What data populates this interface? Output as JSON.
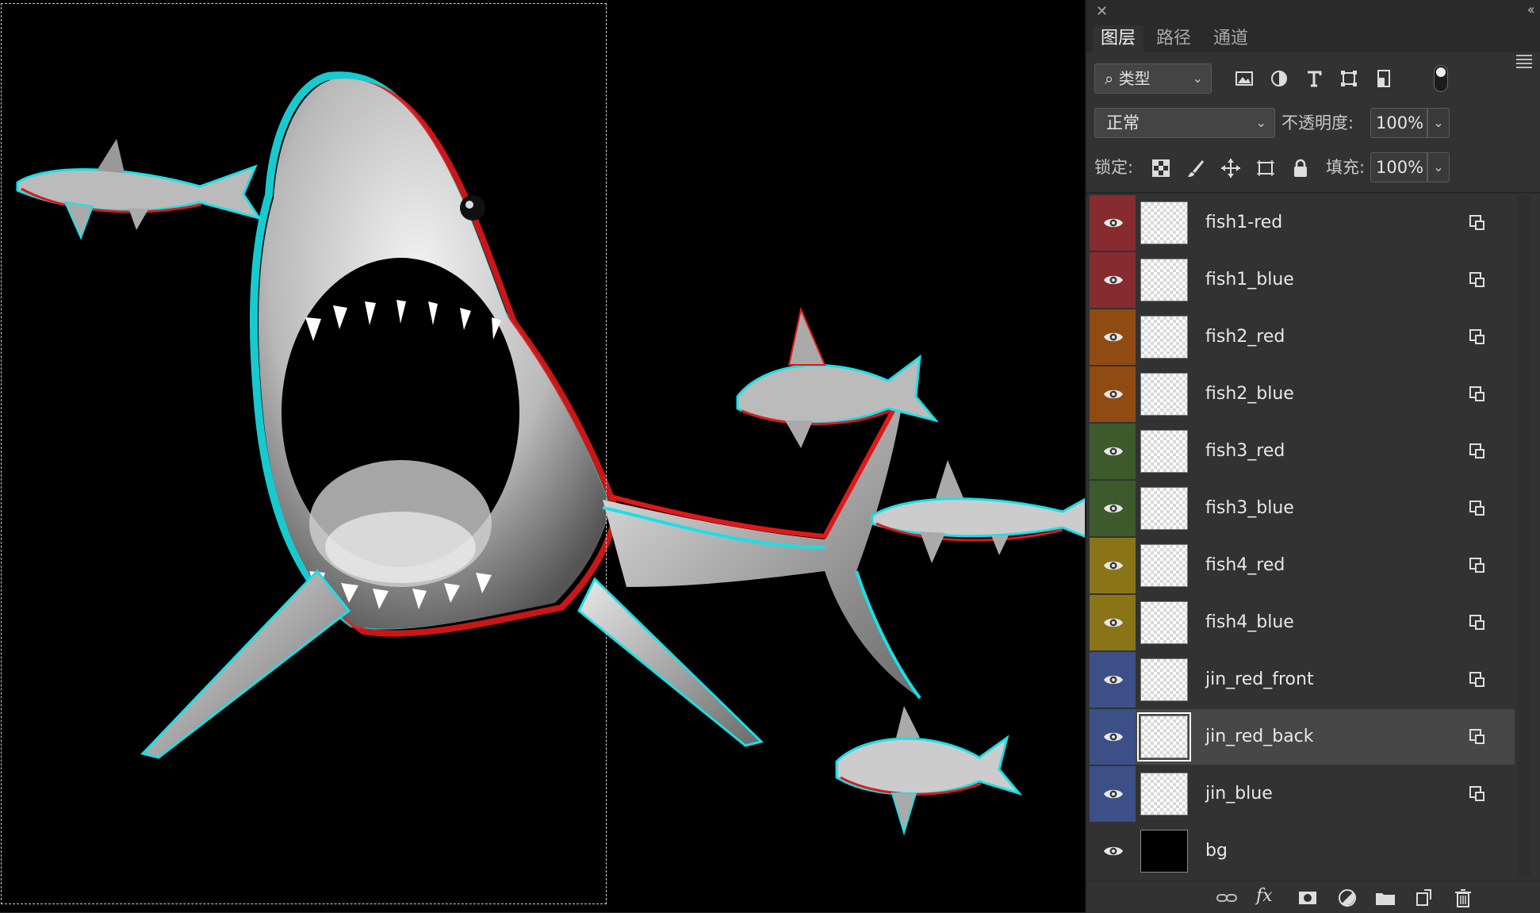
{
  "canvas": {
    "background": "#000000",
    "image_description_icon": "shark-artwork-icon"
  },
  "panel": {
    "tabs": [
      {
        "label": "图层",
        "active": true
      },
      {
        "label": "路径",
        "active": false
      },
      {
        "label": "通道",
        "active": false
      }
    ],
    "filter": {
      "kind_label": "类型",
      "icons": [
        "image-filter-icon",
        "adjustment-filter-icon",
        "type-filter-icon",
        "shape-filter-icon",
        "smart-object-filter-icon"
      ]
    },
    "blend_mode": "正常",
    "opacity_label": "不透明度:",
    "opacity_value": "100%",
    "lock_label": "锁定:",
    "fill_label": "填充:",
    "fill_value": "100%",
    "colors": {
      "red": "#862b2f",
      "orange": "#8f4b12",
      "green": "#3c5a2c",
      "yellow": "#8a7418",
      "blue": "#3c4f86",
      "none": "#323232"
    },
    "layers": [
      {
        "name": "fish1-red",
        "color": "red",
        "thumb": "transparent",
        "smart": true,
        "selected": false
      },
      {
        "name": "fish1_blue",
        "color": "red",
        "thumb": "transparent",
        "smart": true,
        "selected": false
      },
      {
        "name": "fish2_red",
        "color": "orange",
        "thumb": "transparent",
        "smart": true,
        "selected": false
      },
      {
        "name": "fish2_blue",
        "color": "orange",
        "thumb": "transparent",
        "smart": true,
        "selected": false
      },
      {
        "name": "fish3_red",
        "color": "green",
        "thumb": "transparent",
        "smart": true,
        "selected": false
      },
      {
        "name": "fish3_blue",
        "color": "green",
        "thumb": "transparent",
        "smart": true,
        "selected": false
      },
      {
        "name": "fish4_red",
        "color": "yellow",
        "thumb": "transparent",
        "smart": true,
        "selected": false
      },
      {
        "name": "fish4_blue",
        "color": "yellow",
        "thumb": "transparent",
        "smart": true,
        "selected": false
      },
      {
        "name": "jin_red_front",
        "color": "blue",
        "thumb": "transparent",
        "smart": true,
        "selected": false
      },
      {
        "name": "jin_red_back",
        "color": "blue",
        "thumb": "transparent",
        "smart": true,
        "selected": true
      },
      {
        "name": "jin_blue",
        "color": "blue",
        "thumb": "transparent",
        "smart": true,
        "selected": false
      },
      {
        "name": "bg",
        "color": "none",
        "thumb": "black",
        "smart": false,
        "selected": false
      }
    ],
    "bottom_icons": [
      "link-layers-icon",
      "fx-icon",
      "add-mask-icon",
      "adjustment-layer-icon",
      "new-group-icon",
      "new-layer-icon",
      "trash-icon"
    ]
  }
}
